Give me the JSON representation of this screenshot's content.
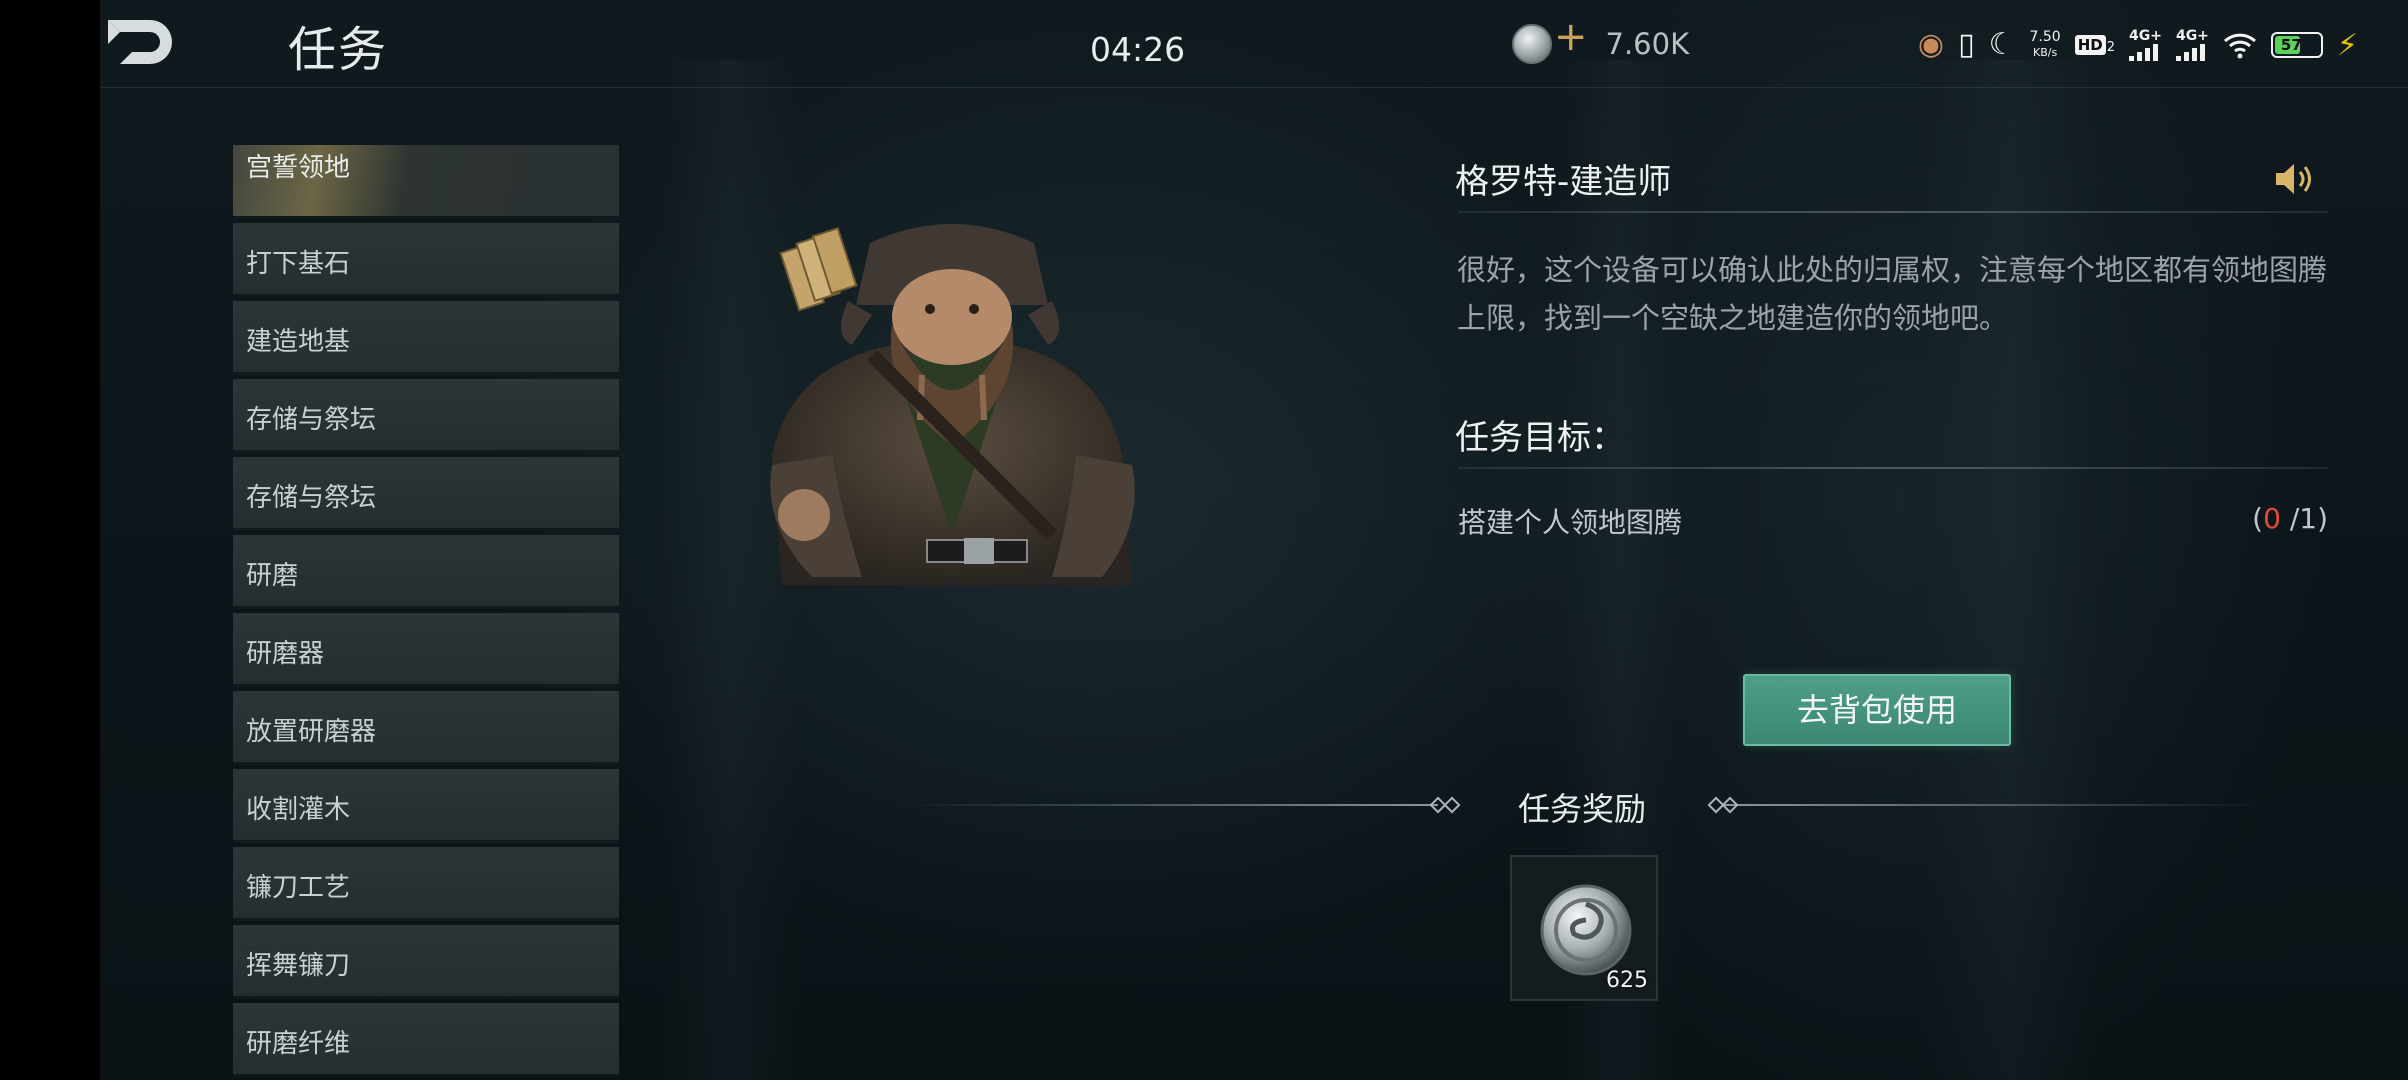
{
  "header": {
    "title": "任务",
    "clock": "04:26",
    "currency_value": "7.60K"
  },
  "statusbar": {
    "net_speed": "7.50",
    "net_unit": "KB/s",
    "hd_label": "HD",
    "hd_sub": "2",
    "sim1_label": "4G+",
    "sim2_label": "4G+",
    "battery_percent": "57",
    "battery_level": 0.57
  },
  "quest_list": {
    "items": [
      {
        "label": "宫誓领地",
        "active": true
      },
      {
        "label": "打下基石"
      },
      {
        "label": "建造地基"
      },
      {
        "label": "存储与祭坛"
      },
      {
        "label": "存储与祭坛"
      },
      {
        "label": "研磨"
      },
      {
        "label": "研磨器"
      },
      {
        "label": "放置研磨器"
      },
      {
        "label": "收割灌木"
      },
      {
        "label": "镰刀工艺"
      },
      {
        "label": "挥舞镰刀"
      },
      {
        "label": "研磨纤维"
      }
    ]
  },
  "detail": {
    "npc_name": "格罗特-建造师",
    "dialog": "很好，这个设备可以确认此处的归属权，注意每个地区都有领地图腾上限，找到一个空缺之地建造你的领地吧。",
    "objective_title": "任务目标：",
    "objective_text": "搭建个人领地图腾",
    "objective_open": "(",
    "objective_current": "0",
    "objective_total": " /1)",
    "use_button_label": "去背包使用"
  },
  "reward": {
    "title": "任务奖励",
    "item_count": "625"
  },
  "colors": {
    "accent_green": "#4f9e88",
    "progress_red": "#e24a3a",
    "currency_gold": "#c9a35a"
  }
}
